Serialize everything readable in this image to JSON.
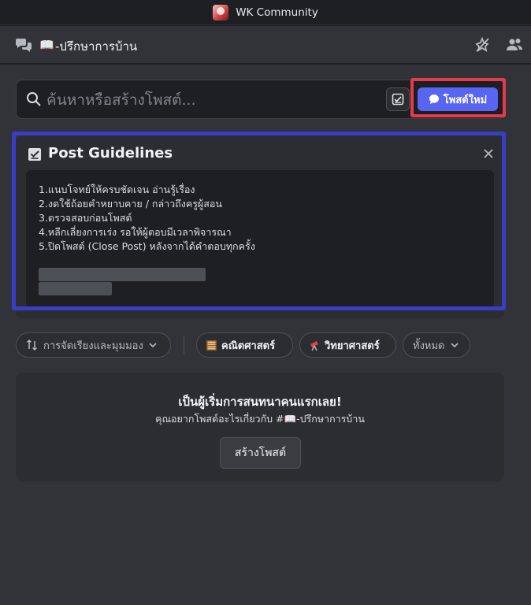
{
  "window": {
    "title": "WK Community"
  },
  "channel": {
    "emoji": "📖",
    "name": "-ปรึกษาการบ้าน"
  },
  "search": {
    "placeholder": "ค้นหาหรือสร้างโพสต์..."
  },
  "toolbar": {
    "new_post_label": "โพสต์ใหม่"
  },
  "guidelines": {
    "title": "Post Guidelines",
    "items": [
      "1.แนบโจทย์ให้ครบชัดเจน อ่านรู้เรื่อง",
      "2.งดใช้ถ้อยคำหยาบคาย / กล่าวถึงครูผู้สอน",
      "3.ตรวจสอบก่อนโพสต์",
      "4.หลีกเลี่ยงการเร่ง รอให้ผู้ตอบมีเวลาพิจารณา",
      "5.ปิดโพสต์ (Close Post) หลังจากได้คำตอบทุกครั้ง"
    ]
  },
  "filters": {
    "sort_label": "การจัดเรียงและมุมมอง",
    "tags": [
      {
        "icon": "abacus-icon",
        "label": "คณิตศาสตร์"
      },
      {
        "icon": "telescope-icon",
        "label": "วิทยาศาสตร์"
      }
    ],
    "all_label": "ทั้งหมด"
  },
  "empty_state": {
    "title": "เป็นผู้เริ่มการสนทนาคนแรกเลย!",
    "subtitle": "คุณอยากโพสต์อะไรเกี่ยวกับ #📖-ปรึกษาการบ้าน",
    "button_label": "สร้างโพสต์"
  },
  "colors": {
    "accent": "#5865f2",
    "highlight_red": "#e5394d",
    "highlight_blue": "#3a3dc7",
    "background": "#313338"
  }
}
